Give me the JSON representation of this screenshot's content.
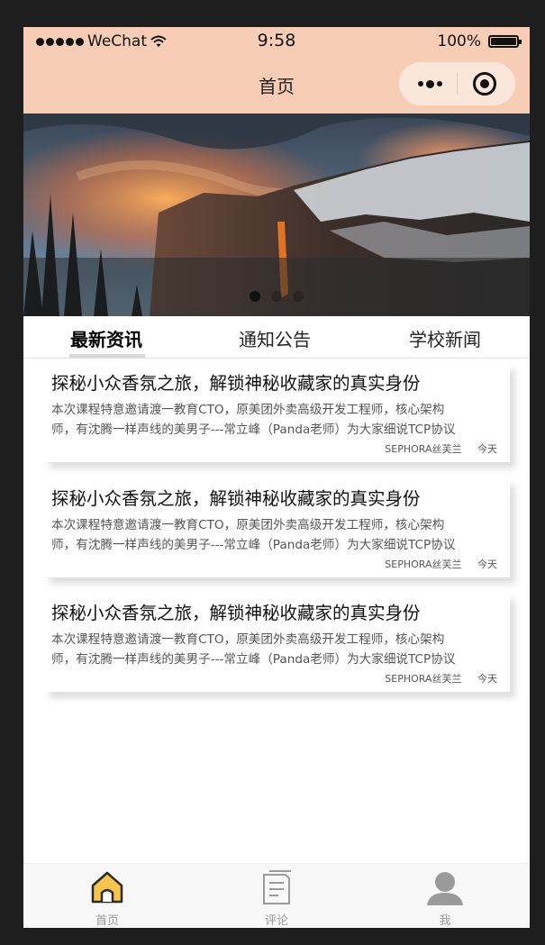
{
  "status_bar": {
    "carrier": "WeChat",
    "time": "9:58",
    "battery": "100%"
  },
  "nav": {
    "title": "首页"
  },
  "banner": {
    "slide_count": 3,
    "active_index": 0
  },
  "tabs": [
    {
      "label": "最新资讯",
      "active": true
    },
    {
      "label": "通知公告",
      "active": false
    },
    {
      "label": "学校新闻",
      "active": false
    }
  ],
  "articles": [
    {
      "title": "探秘小众香氛之旅，解锁神秘收藏家的真实身份",
      "desc_line1": "本次课程特意邀请渡一教育CTO，原美团外卖高级开发工程师，核心架构",
      "desc_line2": "师，有沈腾一样声线的美男子---常立峰（Panda老师）为大家细说TCP协议",
      "source": "SEPHORA丝芙兰",
      "date": "今天"
    },
    {
      "title": "探秘小众香氛之旅，解锁神秘收藏家的真实身份",
      "desc_line1": "本次课程特意邀请渡一教育CTO，原美团外卖高级开发工程师，核心架构",
      "desc_line2": "师，有沈腾一样声线的美男子---常立峰（Panda老师）为大家细说TCP协议",
      "source": "SEPHORA丝芙兰",
      "date": "今天"
    },
    {
      "title": "探秘小众香氛之旅，解锁神秘收藏家的真实身份",
      "desc_line1": "本次课程特意邀请渡一教育CTO，原美团外卖高级开发工程师，核心架构",
      "desc_line2": "师，有沈腾一样声线的美男子---常立峰（Panda老师）为大家细说TCP协议",
      "source": "SEPHORA丝芙兰",
      "date": "今天"
    }
  ],
  "tabbar": [
    {
      "label": "首页",
      "icon": "home-icon",
      "active": true
    },
    {
      "label": "评论",
      "icon": "document-icon",
      "active": false
    },
    {
      "label": "我",
      "icon": "user-icon",
      "active": false
    }
  ],
  "colors": {
    "navbar_bg": "#f7cdb5",
    "active_tab_icon": "#f5c64b"
  }
}
